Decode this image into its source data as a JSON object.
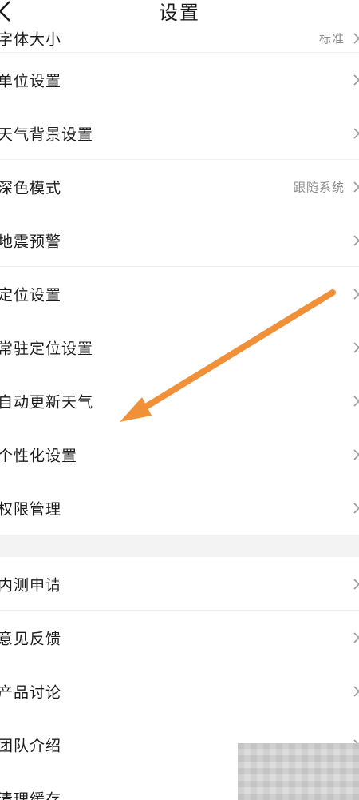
{
  "header": {
    "title": "设置",
    "back_icon": "chevron-left-icon"
  },
  "settings": {
    "group1": [
      {
        "label": "字体大小",
        "value": "标准"
      },
      {
        "label": "单位设置",
        "value": ""
      },
      {
        "label": "天气背景设置",
        "value": ""
      },
      {
        "label": "深色模式",
        "value": "跟随系统"
      },
      {
        "label": "地震预警",
        "value": ""
      },
      {
        "label": "定位设置",
        "value": ""
      },
      {
        "label": "常驻定位设置",
        "value": ""
      },
      {
        "label": "自动更新天气",
        "value": ""
      },
      {
        "label": "个性化设置",
        "value": ""
      },
      {
        "label": "权限管理",
        "value": ""
      }
    ],
    "group2": [
      {
        "label": "内测申请",
        "value": ""
      },
      {
        "label": "意见反馈",
        "value": ""
      },
      {
        "label": "产品讨论",
        "value": ""
      },
      {
        "label": "团队介绍",
        "value": ""
      },
      {
        "label": "清理缓存",
        "value": ""
      }
    ]
  },
  "annotation": {
    "arrow_color": "#F0913A",
    "arrow_icon": "arrow-annotation-icon"
  },
  "colors": {
    "separator": "#efefef",
    "group_gap": "#f3f3f3",
    "secondary_text": "#8a8a8a"
  }
}
